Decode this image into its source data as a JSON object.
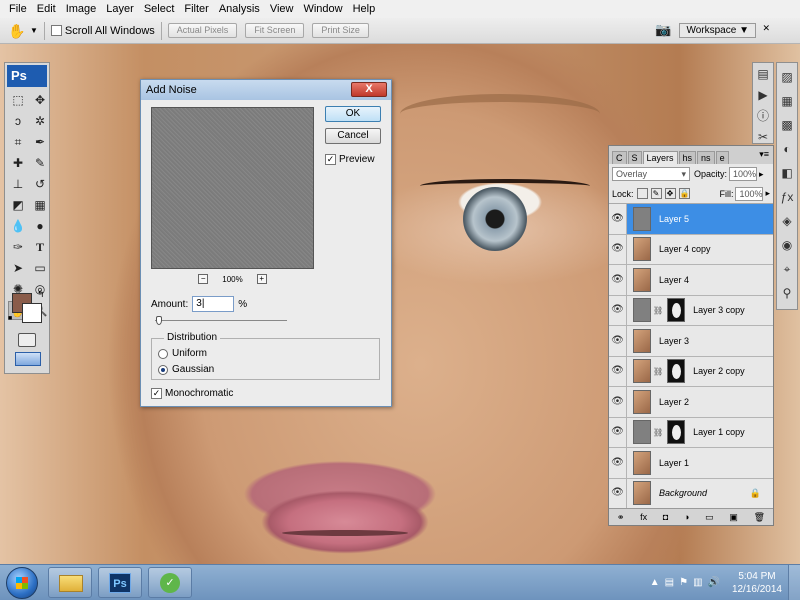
{
  "menu": [
    "File",
    "Edit",
    "Image",
    "Layer",
    "Select",
    "Filter",
    "Analysis",
    "View",
    "Window",
    "Help"
  ],
  "options": {
    "scroll_all": "Scroll All Windows",
    "actual_pixels": "Actual Pixels",
    "fit_screen": "Fit Screen",
    "print_size": "Print Size",
    "workspace": "Workspace"
  },
  "tools": {
    "logo": "Ps"
  },
  "dialog": {
    "title": "Add Noise",
    "close": "X",
    "ok": "OK",
    "cancel": "Cancel",
    "preview_label": "Preview",
    "zoom": "100%",
    "zoom_out": "−",
    "zoom_in": "+",
    "amount_label": "Amount:",
    "amount_value": "3",
    "amount_unit": "%",
    "amount_fraction": 0.03,
    "distribution_label": "Distribution",
    "uniform": "Uniform",
    "gaussian": "Gaussian",
    "monochromatic": "Monochromatic"
  },
  "layers_panel": {
    "tabs": [
      "C",
      "S",
      "Layers",
      "hs",
      "ns",
      "e"
    ],
    "blend_mode": "Overlay",
    "opacity_label": "Opacity:",
    "opacity": "100%",
    "lock_label": "Lock:",
    "fill_label": "Fill:",
    "fill": "100%",
    "layers": [
      {
        "name": "Layer 5",
        "thumb": "gray",
        "mask": false,
        "active": true
      },
      {
        "name": "Layer 4 copy",
        "thumb": "photo",
        "mask": false,
        "active": false
      },
      {
        "name": "Layer 4",
        "thumb": "photo",
        "mask": false,
        "active": false
      },
      {
        "name": "Layer 3 copy",
        "thumb": "gray",
        "mask": true,
        "active": false
      },
      {
        "name": "Layer 3",
        "thumb": "photo",
        "mask": false,
        "active": false
      },
      {
        "name": "Layer 2 copy",
        "thumb": "photo",
        "mask": true,
        "active": false
      },
      {
        "name": "Layer 2",
        "thumb": "photo",
        "mask": false,
        "active": false
      },
      {
        "name": "Layer 1 copy",
        "thumb": "gray",
        "mask": true,
        "active": false
      },
      {
        "name": "Layer 1",
        "thumb": "photo",
        "mask": false,
        "active": false
      },
      {
        "name": "Background",
        "thumb": "photo",
        "mask": false,
        "active": false,
        "locked": true
      }
    ]
  },
  "taskbar": {
    "time": "5:04 PM",
    "date": "12/16/2014",
    "ps_label": "Ps"
  }
}
